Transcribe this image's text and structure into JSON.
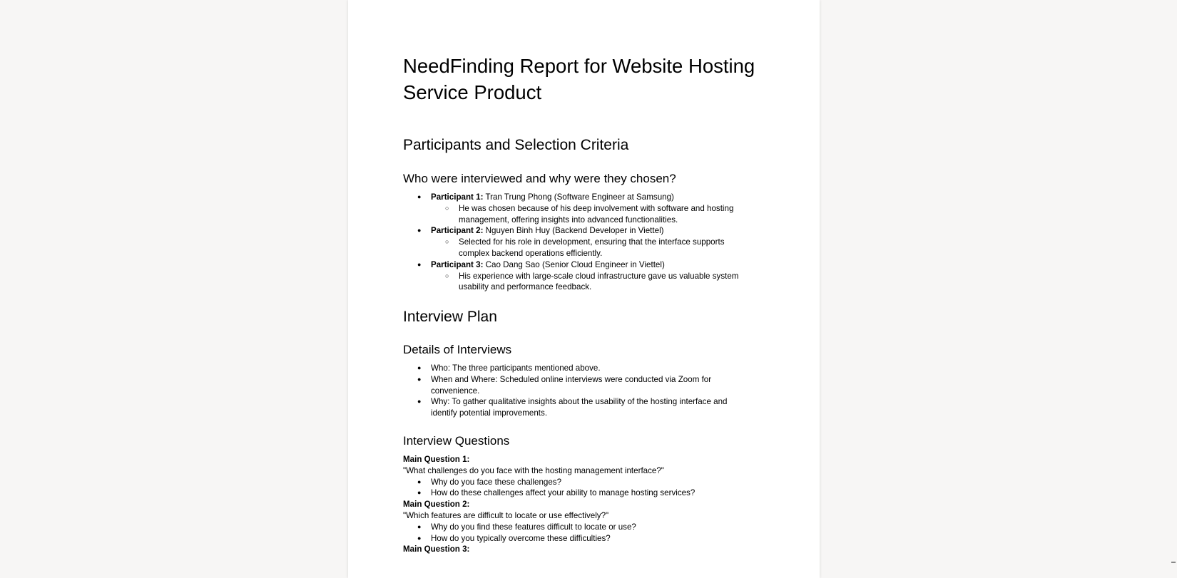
{
  "document": {
    "title": "NeedFinding Report for Website Hosting Service Product",
    "participants_section": {
      "heading": "Participants and Selection Criteria",
      "subheading": "Who were interviewed and why were they chosen?",
      "items": [
        {
          "label": "Participant 1:",
          "text": " Tran Trung Phong (Software Engineer at Samsung)",
          "reason_line1": "He was chosen because of his deep involvement with software and hosting",
          "reason_line2": "management, offering insights into advanced functionalities."
        },
        {
          "label": "Participant 2:",
          "text": " Nguyen Binh Huy (Backend Developer in Viettel)",
          "reason_line1": "Selected for his role in development, ensuring that the interface supports",
          "reason_line2": "complex backend operations efficiently."
        },
        {
          "label": "Participant 3:",
          "text": " Cao Dang Sao (Senior Cloud Engineer in Viettel)",
          "reason_line1": "His experience with large-scale cloud infrastructure gave us valuable system",
          "reason_line2": "usability and performance feedback."
        }
      ]
    },
    "interview_plan": {
      "heading": "Interview Plan",
      "details_heading": "Details of Interviews",
      "details": [
        "Who: The three participants mentioned above.",
        "When and Where: Scheduled online interviews were conducted via Zoom for",
        "convenience.",
        "Why: To gather qualitative insights about the usability of the hosting interface and",
        "identify potential improvements."
      ]
    },
    "questions": {
      "heading": "Interview Questions",
      "q1_label": "Main Question 1:",
      "q1_text": "\"What challenges do you face with the hosting management interface?\"",
      "q1_followups": [
        "Why do you face these challenges?",
        "How do these challenges affect your ability to manage hosting services?"
      ],
      "q2_label": "Main Question 2:",
      "q2_text": "\"Which features are difficult to locate or use effectively?\"",
      "q2_followups": [
        "Why do you find these features difficult to locate or use?",
        "How do you typically overcome these difficulties?"
      ],
      "q3_label": "Main Question 3:"
    },
    "bullet_glyph": "●",
    "sub_bullet_glyph": "○"
  }
}
